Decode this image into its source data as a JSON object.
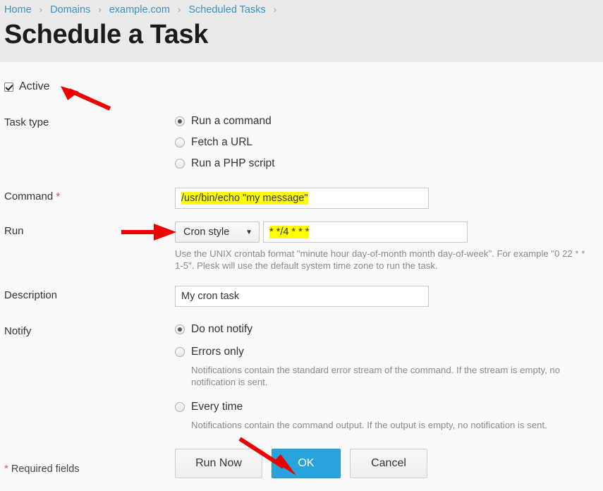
{
  "breadcrumb": {
    "separator": "›",
    "items": [
      {
        "label": "Home"
      },
      {
        "label": "Domains"
      },
      {
        "label": "example.com"
      },
      {
        "label": "Scheduled Tasks"
      }
    ]
  },
  "header": {
    "title": "Schedule a Task",
    "band_color": "#ebeaea",
    "link_color": "#3d8fc4"
  },
  "form": {
    "active": {
      "label": "Active",
      "checked": true
    },
    "task_type": {
      "label": "Task type",
      "options": [
        {
          "label": "Run a command",
          "selected": true
        },
        {
          "label": "Fetch a URL",
          "selected": false
        },
        {
          "label": "Run a PHP script",
          "selected": false
        }
      ]
    },
    "command": {
      "label": "Command",
      "required_marker": "*",
      "value": "/usr/bin/echo \"my message\"",
      "highlighted": true
    },
    "run": {
      "label": "Run",
      "mode_value": "Cron style",
      "mode_chevron": "▼",
      "schedule_value": "* */4 * * *",
      "schedule_highlighted": true,
      "hint": "Use the UNIX crontab format \"minute hour day-of-month month day-of-week\". For example \"0 22 * * 1-5\". Plesk will use the default system time zone to run the task."
    },
    "description": {
      "label": "Description",
      "value": "My cron task"
    },
    "notify": {
      "label": "Notify",
      "options": [
        {
          "label": "Do not notify",
          "selected": true,
          "hint": ""
        },
        {
          "label": "Errors only",
          "selected": false,
          "hint": "Notifications contain the standard error stream of the command. If the stream is empty, no notification is sent."
        },
        {
          "label": "Every time",
          "selected": false,
          "hint": "Notifications contain the command output. If the output is empty, no notification is sent."
        }
      ]
    }
  },
  "footer": {
    "required_note_star": "*",
    "required_note": "Required fields",
    "run_now_label": "Run Now",
    "ok_label": "OK",
    "cancel_label": "Cancel",
    "primary_color": "#29a3db"
  },
  "annotations": {
    "arrow_color": "#ee0000",
    "arrow_active_target": "active-checkbox",
    "arrow_run_target": "run-mode-dropdown",
    "arrow_ok_target": "ok-button"
  }
}
